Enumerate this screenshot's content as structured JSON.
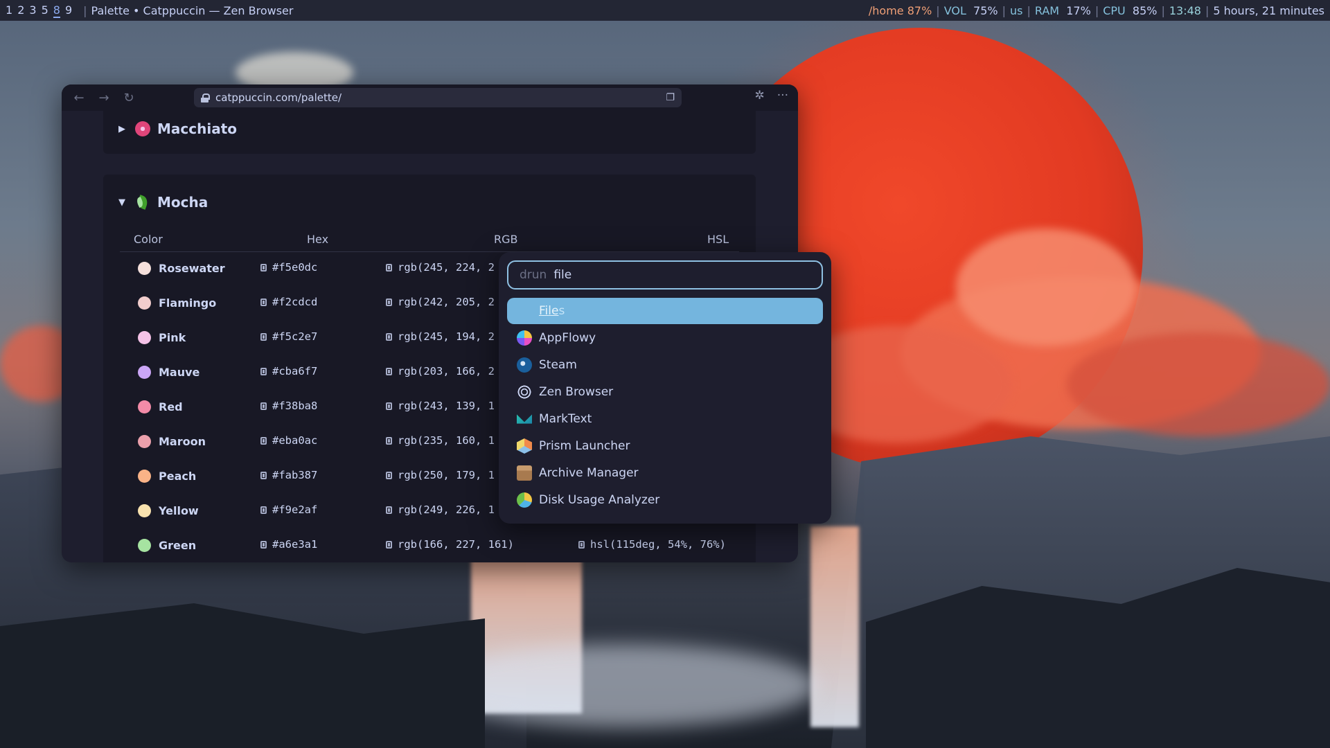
{
  "topbar": {
    "workspaces": [
      "1",
      "2",
      "3",
      "5",
      "8",
      "9"
    ],
    "active_workspace": "8",
    "window_title": "Palette • Catppuccin — Zen Browser",
    "home": "/home 87%",
    "vol_label": "VOL",
    "vol_value": "75%",
    "kbd_layout": "us",
    "ram_label": "RAM",
    "ram_value": "17%",
    "cpu_label": "CPU",
    "cpu_value": "85%",
    "clock": "13:48",
    "battery": "5 hours, 21 minutes"
  },
  "browser": {
    "url": "catppuccin.com/palette/",
    "back_icon": "arrow-left-icon",
    "forward_icon": "arrow-right-icon",
    "reload_icon": "reload-icon",
    "extensions_icon": "puzzle-icon",
    "menu_icon": "more-horizontal-icon"
  },
  "palette": {
    "sections": [
      {
        "name": "Macchiato",
        "expanded": false
      },
      {
        "name": "Mocha",
        "expanded": true
      }
    ],
    "columns": [
      "Color",
      "Hex",
      "RGB",
      "HSL"
    ],
    "rows": [
      {
        "name": "Rosewater",
        "hex": "#f5e0dc",
        "rgb": "rgb(245, 224, 2",
        "hsl": ""
      },
      {
        "name": "Flamingo",
        "hex": "#f2cdcd",
        "rgb": "rgb(242, 205, 2",
        "hsl": ""
      },
      {
        "name": "Pink",
        "hex": "#f5c2e7",
        "rgb": "rgb(245, 194, 2",
        "hsl": ""
      },
      {
        "name": "Mauve",
        "hex": "#cba6f7",
        "rgb": "rgb(203, 166, 2",
        "hsl": ""
      },
      {
        "name": "Red",
        "hex": "#f38ba8",
        "rgb": "rgb(243, 139, 1",
        "hsl": ""
      },
      {
        "name": "Maroon",
        "hex": "#eba0ac",
        "rgb": "rgb(235, 160, 1",
        "hsl": ""
      },
      {
        "name": "Peach",
        "hex": "#fab387",
        "rgb": "rgb(250, 179, 1",
        "hsl": ""
      },
      {
        "name": "Yellow",
        "hex": "#f9e2af",
        "rgb": "rgb(249, 226, 1",
        "hsl": ""
      },
      {
        "name": "Green",
        "hex": "#a6e3a1",
        "rgb": "rgb(166, 227, 161)",
        "hsl": "hsl(115deg, 54%, 76%)"
      }
    ]
  },
  "launcher": {
    "mode": "drun",
    "query": "file",
    "items": [
      {
        "label": "Files",
        "icon": "files-icon",
        "selected": true
      },
      {
        "label": "AppFlowy",
        "icon": "appflowy-icon",
        "selected": false
      },
      {
        "label": "Steam",
        "icon": "steam-icon",
        "selected": false
      },
      {
        "label": "Zen Browser",
        "icon": "zen-browser-icon",
        "selected": false
      },
      {
        "label": "MarkText",
        "icon": "marktext-icon",
        "selected": false
      },
      {
        "label": "Prism Launcher",
        "icon": "prism-launcher-icon",
        "selected": false
      },
      {
        "label": "Archive Manager",
        "icon": "archive-manager-icon",
        "selected": false
      },
      {
        "label": "Disk Usage Analyzer",
        "icon": "disk-usage-analyzer-icon",
        "selected": false
      }
    ]
  },
  "colors": {
    "accent": "#8caaee",
    "launcher_selection": "#74b5de",
    "window_bg": "#1e1e2e"
  }
}
